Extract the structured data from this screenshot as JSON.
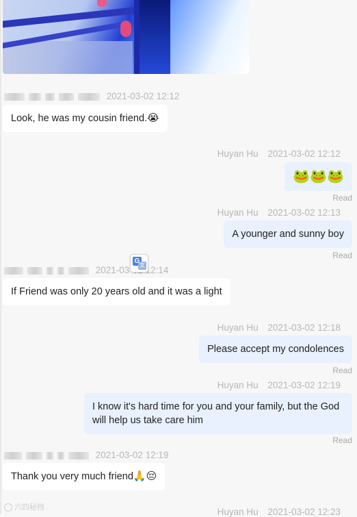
{
  "messages": [
    {
      "direction": "in",
      "time": "2021-03-02 12:12",
      "text": "Look, he was my cousin friend.",
      "emoji": "😭"
    },
    {
      "direction": "out",
      "sender": "Huyan Hu",
      "time": "2021-03-02 12:12",
      "text": "🐸🐸🐸",
      "status": "Read"
    },
    {
      "direction": "out",
      "sender": "Huyan Hu",
      "time": "2021-03-02 12:13",
      "text": "A younger and sunny boy",
      "status": "Read"
    },
    {
      "direction": "in",
      "time": "2021-03-02 12:14",
      "text": "If Friend was only 20 years old and it was a light"
    },
    {
      "direction": "out",
      "sender": "Huyan Hu",
      "time": "2021-03-02 12:18",
      "text": "Please accept my condolences",
      "status": "Read"
    },
    {
      "direction": "out",
      "sender": "Huyan Hu",
      "time": "2021-03-02 12:19",
      "text": "I know it's hard time for you and your family, but the God will help us take care him",
      "status": "Read"
    },
    {
      "direction": "in",
      "time": "2021-03-02 12:19",
      "text": "Thank you very much friend",
      "emoji": "🙏😔"
    },
    {
      "direction": "out",
      "sender": "Huyan Hu",
      "time": "2021-03-02 12:23"
    }
  ],
  "translate_button": {
    "glyph_front": "G",
    "glyph_back": "文"
  },
  "watermark": {
    "text": "六四秘档"
  }
}
